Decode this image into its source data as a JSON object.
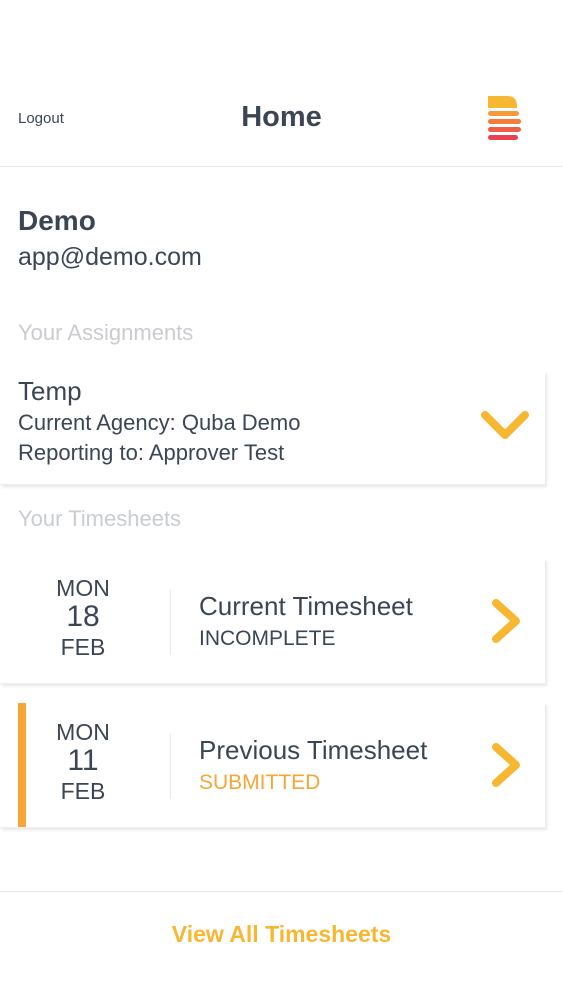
{
  "nav": {
    "logout_label": "Logout",
    "title": "Home",
    "logo_icon": "stacked-bars-logo"
  },
  "user": {
    "name": "Demo",
    "email": "app@demo.com"
  },
  "assignments": {
    "section_label": "Your Assignments",
    "items": [
      {
        "role": "Temp",
        "agency": "Current Agency: Quba Demo",
        "reporting": "Reporting to: Approver Test",
        "icon": "chevron-down-icon"
      }
    ]
  },
  "timesheets": {
    "section_label": "Your Timesheets",
    "items": [
      {
        "dow": "MON",
        "day": "18",
        "month": "FEB",
        "title": "Current Timesheet",
        "status": "INCOMPLETE",
        "icon": "chevron-right-icon"
      },
      {
        "dow": "MON",
        "day": "11",
        "month": "FEB",
        "title": "Previous Timesheet",
        "status": "SUBMITTED",
        "icon": "chevron-right-icon"
      }
    ]
  },
  "footer": {
    "view_all_label": "View All Timesheets"
  },
  "colors": {
    "accent": "#f7a536",
    "link": "#f7b733",
    "text": "#3b4654",
    "muted": "#c9ccd0"
  }
}
